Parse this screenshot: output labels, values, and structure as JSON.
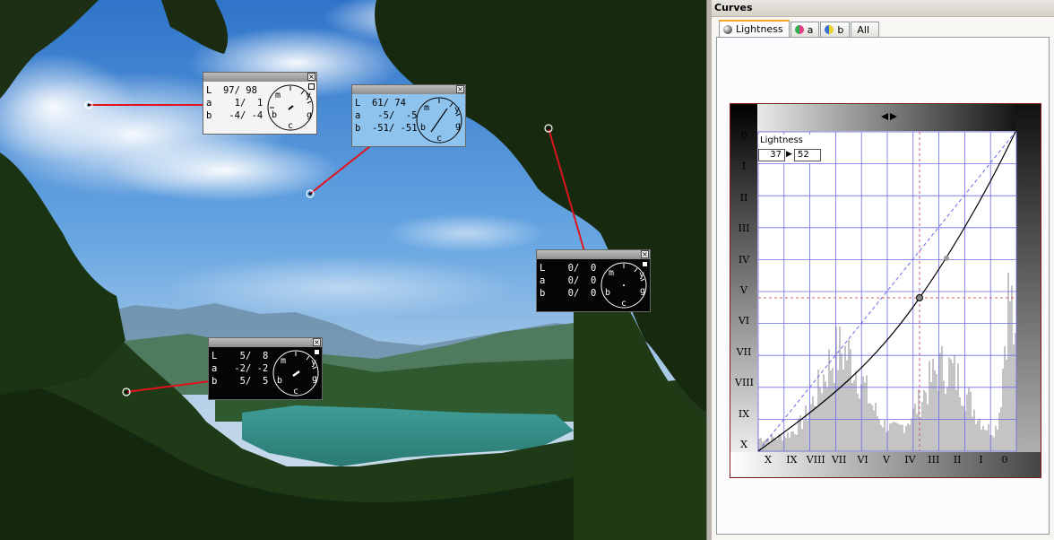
{
  "panel": {
    "title": "Curves",
    "tabs": [
      {
        "label": "Lightness",
        "icon": "sphere-icon",
        "active": true
      },
      {
        "label": "a",
        "icon": "color-ball-icon"
      },
      {
        "label": "b",
        "icon": "color-ball-icon"
      },
      {
        "label": "All"
      }
    ]
  },
  "curve": {
    "channel_label": "Lightness",
    "input_value": "37",
    "output_value": "52",
    "y_labels": [
      "0",
      "I",
      "II",
      "III",
      "IV",
      "V",
      "VI",
      "VII",
      "VIII",
      "IX",
      "X"
    ],
    "x_labels": [
      "X",
      "IX",
      "VIII",
      "VII",
      "VI",
      "V",
      "IV",
      "III",
      "II",
      "I",
      "0"
    ]
  },
  "probes": [
    {
      "theme": "light",
      "rows": [
        [
          "L",
          "97/",
          "98"
        ],
        [
          "a",
          "1/",
          "1"
        ],
        [
          "b",
          "-4/",
          "-4"
        ]
      ],
      "dial_letters": [
        "m",
        "r",
        "y",
        "g",
        "c",
        "b"
      ]
    },
    {
      "theme": "blue",
      "rows": [
        [
          "L",
          "61/",
          "74"
        ],
        [
          "a",
          "-5/",
          "-5"
        ],
        [
          "b",
          "-51/",
          "-51"
        ]
      ],
      "dial_letters": [
        "m",
        "r",
        "y",
        "g",
        "c",
        "b"
      ]
    },
    {
      "theme": "dark",
      "rows": [
        [
          "L",
          "0/",
          "0"
        ],
        [
          "a",
          "0/",
          "0"
        ],
        [
          "b",
          "0/",
          "0"
        ]
      ],
      "dial_letters": [
        "m",
        "r",
        "y",
        "g",
        "c",
        "b"
      ]
    },
    {
      "theme": "dark",
      "rows": [
        [
          "L",
          "5/",
          "8"
        ],
        [
          "a",
          "-2/",
          "-2"
        ],
        [
          "b",
          "5/",
          "5"
        ]
      ],
      "dial_letters": [
        "m",
        "r",
        "y",
        "g",
        "c",
        "b"
      ]
    }
  ],
  "colors": {
    "probe_line": "#e0141e",
    "grid": "#6a6ae8",
    "histogram": "#c4c4c4",
    "frame": "#7a1c1c"
  }
}
